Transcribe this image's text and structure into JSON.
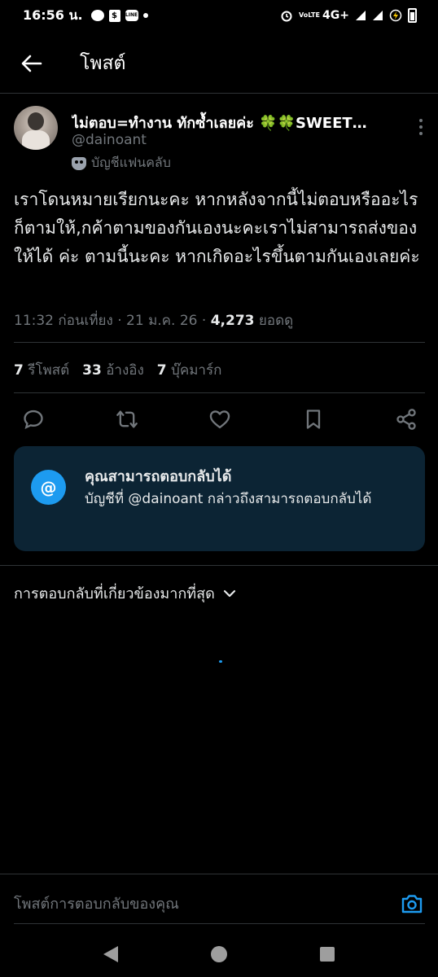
{
  "status_bar": {
    "time": "16:56 น.",
    "network": "4G+",
    "volte": "VoLTE",
    "line_label": "LINE",
    "shop_label": "$"
  },
  "header": {
    "title": "โพสต์"
  },
  "post": {
    "author": {
      "display_name": "ไม่ตอบ=ทำงาน ทักซ้ำเลยค่ะ 🍀🍀SWEET…",
      "handle": "@dainoant",
      "badge": "บัญชีแฟนคลับ"
    },
    "text": "เราโดนหมายเรียกนะคะ หากหลังจากนี้ไม่ตอบหรืออะไรก็ตามให้,กค้าตามของกันเองนะคะเราไม่สามารถส่งของให้ได้ ค่ะ ตามนี้นะคะ หากเกิดอะไรขึ้นตามกันเองเลยค่ะ",
    "time": "11:32 ก่อนเที่ยง",
    "date": "21 ม.ค. 26",
    "views_count": "4,273",
    "views_label": "ยอดดู",
    "separator": "·",
    "stats": {
      "reposts_count": "7",
      "reposts_label": "รีโพสต์",
      "quotes_count": "33",
      "quotes_label": "อ้างอิง",
      "bookmarks_count": "7",
      "bookmarks_label": "บุ๊คมาร์ก"
    }
  },
  "actions": [
    "reply-icon",
    "repost-icon",
    "like-icon",
    "bookmark-icon",
    "share-icon"
  ],
  "mention_card": {
    "icon": "@",
    "title": "คุณสามารถตอบกลับได้",
    "body": "บัญชีที่ @dainoant กล่าวถึงสามารถตอบกลับได้"
  },
  "replies": {
    "sort_label": "การตอบกลับที่เกี่ยวข้องมากที่สุด"
  },
  "compose": {
    "placeholder": "โพสต์การตอบกลับของคุณ"
  },
  "colors": {
    "background": "#000000",
    "accent": "#1d9bf0",
    "muted_text": "#71767b",
    "primary_text": "#e7e9ea",
    "card_bg": "#0c2434",
    "divider": "#2f3336"
  }
}
